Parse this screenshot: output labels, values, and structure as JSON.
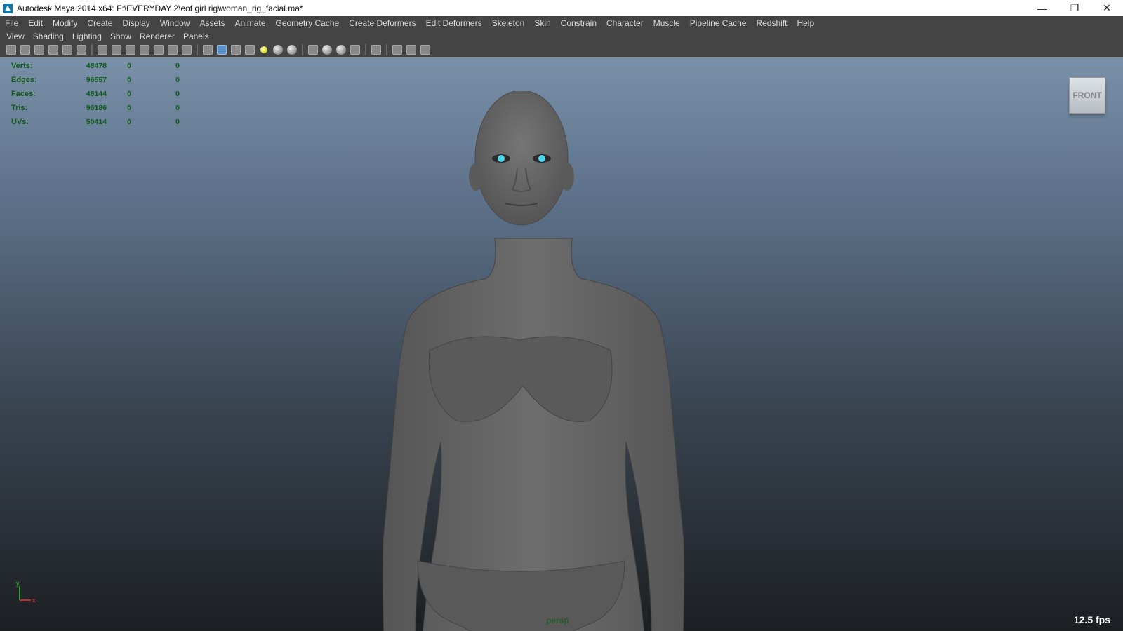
{
  "window": {
    "title": "Autodesk Maya 2014 x64: F:\\EVERYDAY 2\\eof girl rig\\woman_rig_facial.ma*",
    "controls": [
      "—",
      "❐",
      "✕"
    ]
  },
  "menubar": [
    "File",
    "Edit",
    "Modify",
    "Create",
    "Display",
    "Window",
    "Assets",
    "Animate",
    "Geometry Cache",
    "Create Deformers",
    "Edit Deformers",
    "Skeleton",
    "Skin",
    "Constrain",
    "Character",
    "Muscle",
    "Pipeline Cache",
    "Redshift",
    "Help"
  ],
  "panel_menu": [
    "View",
    "Shading",
    "Lighting",
    "Show",
    "Renderer",
    "Panels"
  ],
  "hud": {
    "rows": [
      {
        "label": "Verts:",
        "v1": "48478",
        "v2": "0",
        "v3": "0"
      },
      {
        "label": "Edges:",
        "v1": "96557",
        "v2": "0",
        "v3": "0"
      },
      {
        "label": "Faces:",
        "v1": "48144",
        "v2": "0",
        "v3": "0"
      },
      {
        "label": "Tris:",
        "v1": "96186",
        "v2": "0",
        "v3": "0"
      },
      {
        "label": "UVs:",
        "v1": "50414",
        "v2": "0",
        "v3": "0"
      }
    ]
  },
  "viewcube": {
    "label": "FRONT"
  },
  "camera_label": "persp",
  "fps": "12.5 fps",
  "axis": {
    "y": "y",
    "x": "x"
  },
  "colors": {
    "hud_text": "#0e5a17",
    "viewport_top": "#7a90a9",
    "viewport_bottom": "#1c1f22",
    "iris": "#4fd4ea"
  }
}
